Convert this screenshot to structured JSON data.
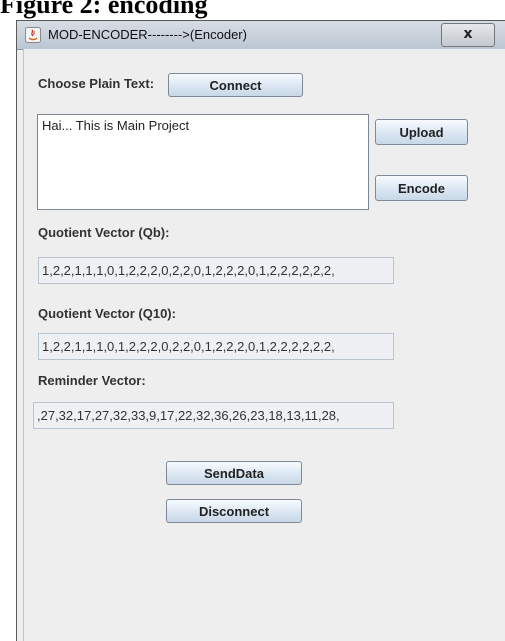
{
  "caption": "Figure 2: encoding",
  "window": {
    "title": "MOD-ENCODER-------->(Encoder)",
    "close_label": "x",
    "app_icon": "java-icon"
  },
  "form": {
    "choose_label": "Choose Plain Text:",
    "connect_label": "Connect",
    "plain_text": "Hai... This is Main Project",
    "upload_label": "Upload",
    "encode_label": "Encode",
    "qb_label": "Quotient Vector (Qb):",
    "qb_value": "1,2,2,1,1,1,0,1,2,2,2,0,2,2,0,1,2,2,2,0,1,2,2,2,2,2,2,",
    "q10_label": "Quotient Vector (Q10):",
    "q10_value": "1,2,2,1,1,1,0,1,2,2,2,0,2,2,0,1,2,2,2,0,1,2,2,2,2,2,2,",
    "remainder_label": "Reminder Vector:",
    "remainder_value": ",27,32,17,27,32,33,9,17,22,32,36,26,23,18,13,11,28,",
    "send_label": "SendData",
    "disconnect_label": "Disconnect"
  }
}
